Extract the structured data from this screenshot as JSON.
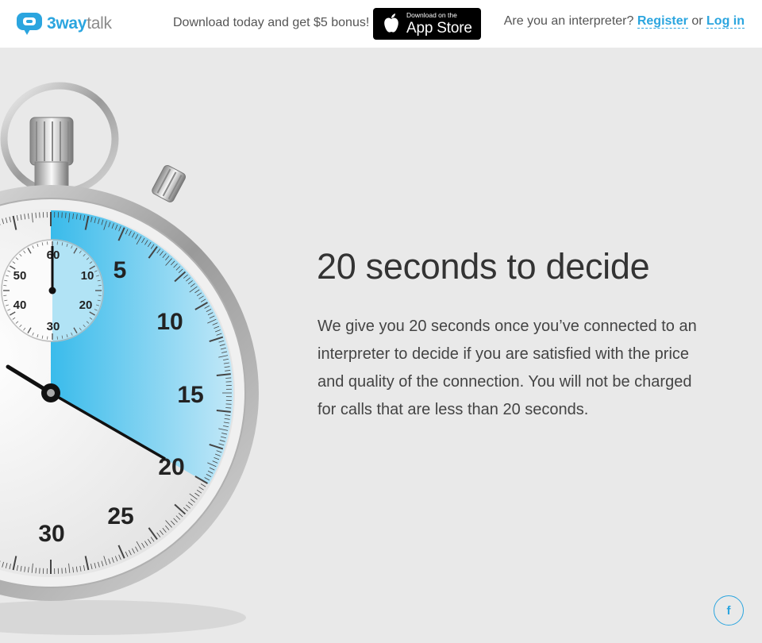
{
  "header": {
    "logo": {
      "bold": "3way",
      "light": "talk"
    },
    "promo_text": "Download today and get $5 bonus!",
    "appstore": {
      "small": "Download on the",
      "big": "App Store"
    },
    "interpreter_question": "Are you an interpreter?",
    "register_label": "Register",
    "or_text": "or",
    "login_label": "Log in"
  },
  "main": {
    "headline": "20 seconds to decide",
    "body": "We give you 20 seconds once you’ve connected to an interpreter to decide if you are satisfied with the price and quality of the connection. You will not be charged for calls that are less than 20 seconds."
  },
  "stopwatch": {
    "dial_numbers": [
      "5",
      "10",
      "15",
      "20",
      "25",
      "30"
    ],
    "subdial_numbers": [
      "60",
      "10",
      "20",
      "30",
      "40",
      "50"
    ]
  },
  "social": {
    "facebook_glyph": "f"
  },
  "colors": {
    "accent": "#2ba5df",
    "highlight": "#29b6ea"
  }
}
